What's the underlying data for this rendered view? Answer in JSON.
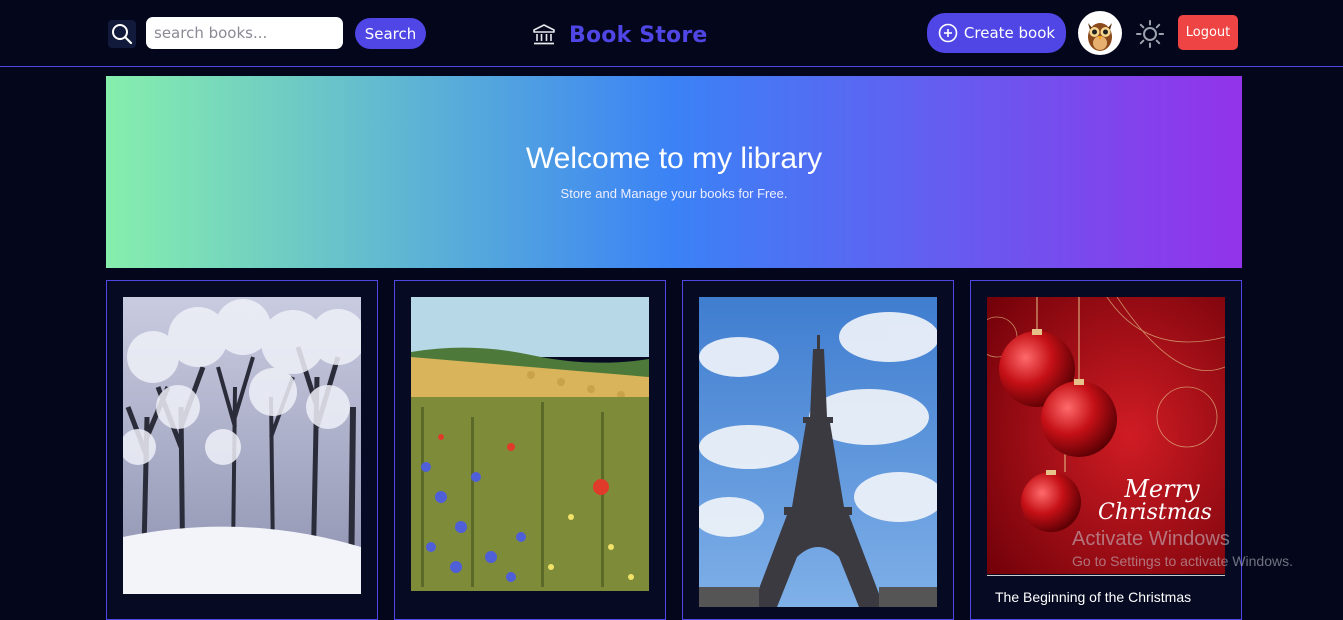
{
  "navbar": {
    "search_placeholder": "search books...",
    "search_button": "Search",
    "brand_title": "Book Store",
    "create_button": "Create book",
    "logout_button": "Logout"
  },
  "hero": {
    "title": "Welcome to my library",
    "subtitle": "Store and Manage your books for Free."
  },
  "books": [
    {
      "title": "",
      "cover": "snowy-forest"
    },
    {
      "title": "",
      "cover": "wildflower-field"
    },
    {
      "title": "",
      "cover": "eiffel-tower"
    },
    {
      "title": "The Beginning of the Christmas",
      "cover": "christmas-ornaments",
      "cover_text": "Merry Christmas"
    }
  ],
  "watermark": {
    "title": "Activate Windows",
    "subtitle": "Go to Settings to activate Windows."
  },
  "colors": {
    "accent": "#4f46e5",
    "background": "#04071b",
    "logout": "#ef4444"
  }
}
